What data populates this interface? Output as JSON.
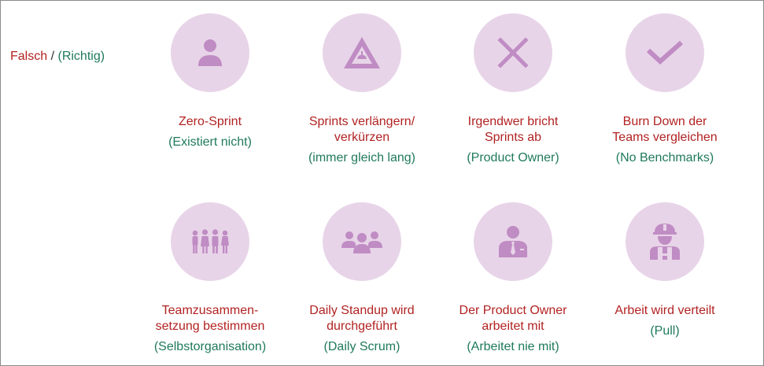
{
  "legend": {
    "false_label": "Falsch",
    "separator": "/",
    "right_label": "(Richtig)"
  },
  "colors": {
    "false_text": "#b22222",
    "right_text": "#1f7a5a",
    "circle_bg": "#e8d4e8",
    "icon": "#c08cc4"
  },
  "cards": [
    {
      "icon": "person-icon",
      "title": "Zero-Sprint",
      "subtitle": "(Existiert nicht)"
    },
    {
      "icon": "warning-triangle-icon",
      "title": "Sprints verlängern/\nverkürzen",
      "subtitle": "(immer gleich lang)"
    },
    {
      "icon": "close-x-icon",
      "title": "Irgendwer bricht\nSprints ab",
      "subtitle": "(Product Owner)"
    },
    {
      "icon": "checkmark-icon",
      "title": "Burn Down der\nTeams vergleichen",
      "subtitle": "(No Benchmarks)"
    },
    {
      "icon": "team-group-icon",
      "title": "Teamzusammen-\nsetzung bestimmen",
      "subtitle": "(Selbstorganisation)"
    },
    {
      "icon": "meeting-group-icon",
      "title": "Daily Standup wird\ndurchgeführt",
      "subtitle": "(Daily Scrum)"
    },
    {
      "icon": "businessman-icon",
      "title": "Der Product Owner\narbeitet mit",
      "subtitle": "(Arbeitet nie mit)"
    },
    {
      "icon": "worker-helmet-icon",
      "title": "Arbeit wird verteilt",
      "subtitle": "(Pull)"
    }
  ]
}
